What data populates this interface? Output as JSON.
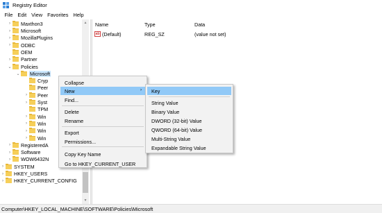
{
  "window": {
    "title": "Registry Editor"
  },
  "menu": [
    "File",
    "Edit",
    "View",
    "Favorites",
    "Help"
  ],
  "tree": [
    {
      "label": "Maxthon3",
      "arrow": ">"
    },
    {
      "label": "Microsoft",
      "arrow": ">"
    },
    {
      "label": "MozillaPlugins",
      "arrow": ">"
    },
    {
      "label": "ODBC",
      "arrow": ">"
    },
    {
      "label": "OEM",
      "arrow": ""
    },
    {
      "label": "Partner",
      "arrow": ">"
    },
    {
      "label": "Policies",
      "arrow": "v"
    },
    {
      "label": "Microsoft",
      "arrow": "v",
      "selected": true
    },
    {
      "label": "Cryp",
      "arrow": ""
    },
    {
      "label": "Peer",
      "arrow": ""
    },
    {
      "label": "Peer",
      "arrow": ">"
    },
    {
      "label": "Syst",
      "arrow": ">"
    },
    {
      "label": "TPM",
      "arrow": ""
    },
    {
      "label": "Win",
      "arrow": ">"
    },
    {
      "label": "Win",
      "arrow": ">"
    },
    {
      "label": "Win",
      "arrow": ">"
    },
    {
      "label": "Win",
      "arrow": ">"
    },
    {
      "label": "RegisteredA",
      "arrow": ">"
    },
    {
      "label": "Software",
      "arrow": ">"
    },
    {
      "label": "WOW6432N",
      "arrow": ">"
    },
    {
      "label": "SYSTEM",
      "arrow": ">"
    },
    {
      "label": "HKEY_USERS",
      "arrow": ">"
    },
    {
      "label": "HKEY_CURRENT_CONFIG",
      "arrow": ">"
    }
  ],
  "list": {
    "columns": [
      "Name",
      "Type",
      "Data"
    ],
    "rows": [
      {
        "name": "(Default)",
        "type": "REG_SZ",
        "data": "(value not set)"
      }
    ]
  },
  "context_menu": {
    "items": [
      "Collapse",
      "New",
      "Find...",
      "Delete",
      "Rename",
      "Export",
      "Permissions...",
      "Copy Key Name",
      "Go to HKEY_CURRENT_USER"
    ],
    "highlighted": "New"
  },
  "submenu": {
    "items": [
      "Key",
      "String Value",
      "Binary Value",
      "DWORD (32-bit) Value",
      "QWORD (64-bit) Value",
      "Multi-String Value",
      "Expandable String Value"
    ],
    "highlighted": "Key"
  },
  "status": {
    "path": "Computer\\HKEY_LOCAL_MACHINE\\SOFTWARE\\Policies\\Microsoft"
  },
  "colors": {
    "highlight": "#91c9f7",
    "selection": "#cce8ff",
    "folder": "#f6cf5a"
  }
}
